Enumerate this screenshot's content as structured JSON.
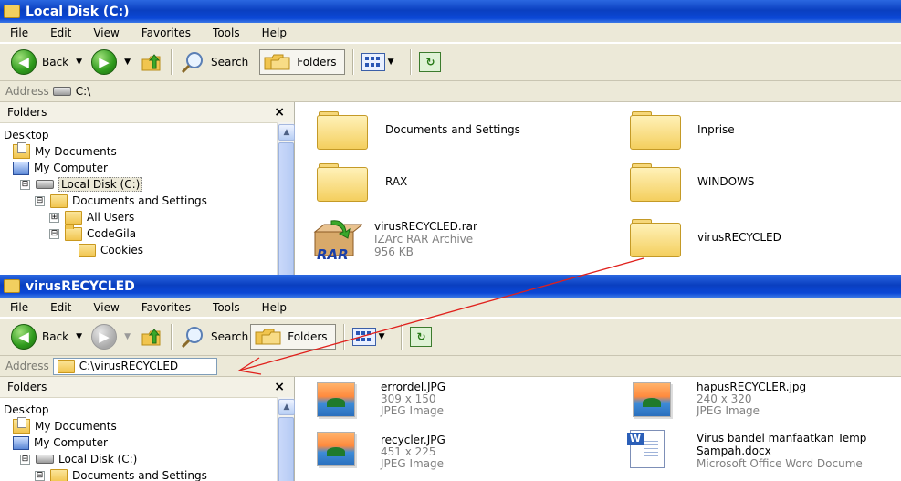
{
  "window1": {
    "title": "Local Disk (C:)",
    "menu": [
      "File",
      "Edit",
      "View",
      "Favorites",
      "Tools",
      "Help"
    ],
    "toolbar": {
      "back": "Back",
      "search": "Search",
      "folders": "Folders"
    },
    "address": {
      "label": "Address",
      "value": "C:\\"
    },
    "folders_pane": {
      "header": "Folders",
      "close": "×",
      "tree": [
        {
          "label": "Desktop",
          "icon": "desktop-icon"
        },
        {
          "label": "My Documents",
          "icon": "my-documents-icon"
        },
        {
          "label": "My Computer",
          "icon": "my-computer-icon"
        },
        {
          "label": "Local Disk (C:)",
          "icon": "drive-icon",
          "expander": "⊟",
          "selected": true
        },
        {
          "label": "Documents and Settings",
          "icon": "folder-icon",
          "expander": "⊟"
        },
        {
          "label": "All Users",
          "icon": "folder-icon",
          "expander": "⊞"
        },
        {
          "label": "CodeGila",
          "icon": "folder-icon",
          "expander": "⊟"
        },
        {
          "label": "Cookies",
          "icon": "folder-icon"
        }
      ]
    },
    "items": [
      {
        "name": "Documents and Settings",
        "type": "folder"
      },
      {
        "name": "Inprise",
        "type": "folder"
      },
      {
        "name": "RAX",
        "type": "folder"
      },
      {
        "name": "WINDOWS",
        "type": "folder"
      },
      {
        "name": "virusRECYCLED.rar",
        "type": "rar",
        "line2": "IZArc RAR Archive",
        "line3": "956 KB",
        "icon_text": "RAR"
      },
      {
        "name": "virusRECYCLED",
        "type": "folder"
      }
    ]
  },
  "window2": {
    "title": "virusRECYCLED",
    "menu": [
      "File",
      "Edit",
      "View",
      "Favorites",
      "Tools",
      "Help"
    ],
    "toolbar": {
      "back": "Back",
      "search": "Search",
      "folders": "Folders"
    },
    "address": {
      "label": "Address",
      "value": "C:\\virusRECYCLED"
    },
    "folders_pane": {
      "header": "Folders",
      "close": "×",
      "tree": [
        {
          "label": "Desktop",
          "icon": "desktop-icon"
        },
        {
          "label": "My Documents",
          "icon": "my-documents-icon"
        },
        {
          "label": "My Computer",
          "icon": "my-computer-icon"
        },
        {
          "label": "Local Disk (C:)",
          "icon": "drive-icon",
          "expander": "⊟"
        },
        {
          "label": "Documents and Settings",
          "icon": "folder-icon",
          "expander": "⊟"
        }
      ]
    },
    "items": [
      {
        "name": "errordel.JPG",
        "line2": "309 x 150",
        "line3": "JPEG Image",
        "type": "jpg"
      },
      {
        "name": "hapusRECYCLER.jpg",
        "line2": "240 x 320",
        "line3": "JPEG Image",
        "type": "jpg"
      },
      {
        "name": "recycler.JPG",
        "line2": "451 x 225",
        "line3": "JPEG Image",
        "type": "jpg"
      },
      {
        "name": "Virus bandel manfaatkan Temp",
        "line2": "Sampah.docx",
        "line3": "Microsoft Office Word Docume",
        "type": "docx"
      }
    ]
  },
  "annotation": {
    "color": "#e0201c"
  },
  "colors": {
    "titlebar": "#0a3fc0",
    "chrome": "#ece9d8"
  }
}
